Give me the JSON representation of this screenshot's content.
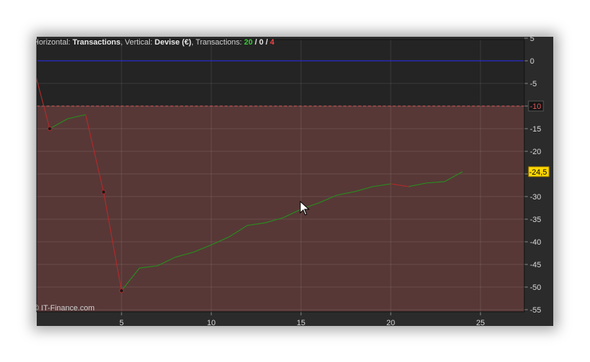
{
  "header": {
    "horizontal_label": "Horizontal: ",
    "horizontal_value": "Transactions",
    "vertical_label": ", Vertical: ",
    "vertical_value": "Devise (€)",
    "transactions_label": ", Transactions: ",
    "wins": "20",
    "sep1": " / ",
    "neutral": "0",
    "sep2": " / ",
    "losses": "4"
  },
  "watermark": "© IT-Finance.com",
  "colors": {
    "gain": "#2a8a1e",
    "loss": "#b02a2a",
    "zero_line": "#2a2aff",
    "threshold": "#e05a5a",
    "drawdown_fill": "#573837",
    "current_label": "#ffd700"
  },
  "chart_data": {
    "type": "line",
    "x": [
      0,
      1,
      2,
      3,
      4,
      5,
      6,
      7,
      8,
      9,
      10,
      11,
      12,
      13,
      14,
      15,
      16,
      17,
      18,
      19,
      20,
      21,
      22,
      23,
      24
    ],
    "values": [
      0,
      -15,
      -12.8,
      -11.9,
      -29,
      -50.8,
      -45.8,
      -45.3,
      -43.4,
      -42.3,
      -40.7,
      -38.9,
      -36.4,
      -35.8,
      -34.7,
      -32.8,
      -31.4,
      -29.7,
      -28.9,
      -27.8,
      -27.2,
      -27.8,
      -27,
      -26.7,
      -24.5
    ],
    "marked_points": [
      1,
      4,
      5
    ],
    "xlim": [
      0.3,
      27.5
    ],
    "ylim": [
      -55.5,
      5
    ],
    "x_ticks": [
      5,
      10,
      15,
      20,
      25
    ],
    "y_ticks": [
      5,
      0,
      -5,
      -10,
      -15,
      -20,
      -25,
      -30,
      -35,
      -40,
      -45,
      -50,
      -55
    ],
    "y_tick_labels": [
      "5",
      "0",
      "-5",
      "-10",
      "-15",
      "-20",
      "",
      "-30",
      "-35",
      "-40",
      "-45",
      "-50",
      "-55"
    ],
    "threshold": -10,
    "threshold_label": "-10",
    "current_value_label": "-24,5",
    "grid": true,
    "y_axis_side": "right"
  }
}
